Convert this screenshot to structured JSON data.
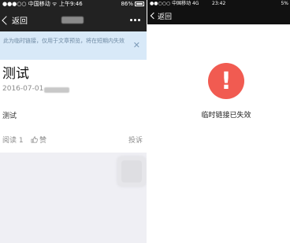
{
  "left_screen": {
    "statusbar": {
      "carrier": "●●●○○ 中国移动 ᯤ",
      "time": "上午9:46",
      "battery": "86%"
    },
    "navbar": {
      "back_label": "返回"
    },
    "notice": {
      "text": "此为临时链接，仅用于文章预览，将在短期内失效",
      "close_icon": "close-icon"
    },
    "article": {
      "title": "测试",
      "date": "2016-07-01",
      "body": "测试",
      "reads": "阅读 1",
      "like": "赞",
      "report": "投诉"
    },
    "colors": {
      "bar": "#222222",
      "notice_bg": "#d8e9f8",
      "page_bg": "#efeff4"
    }
  },
  "right_screen": {
    "statusbar": {
      "carrier": "●●○○○ 中国移动 4G",
      "time": "23:42",
      "battery": "5%"
    },
    "navbar": {
      "back_label": "返回"
    },
    "error": {
      "icon": "!",
      "message": "临时链接已失效"
    },
    "colors": {
      "bar": "#111111",
      "error_red": "#f15b51"
    }
  }
}
